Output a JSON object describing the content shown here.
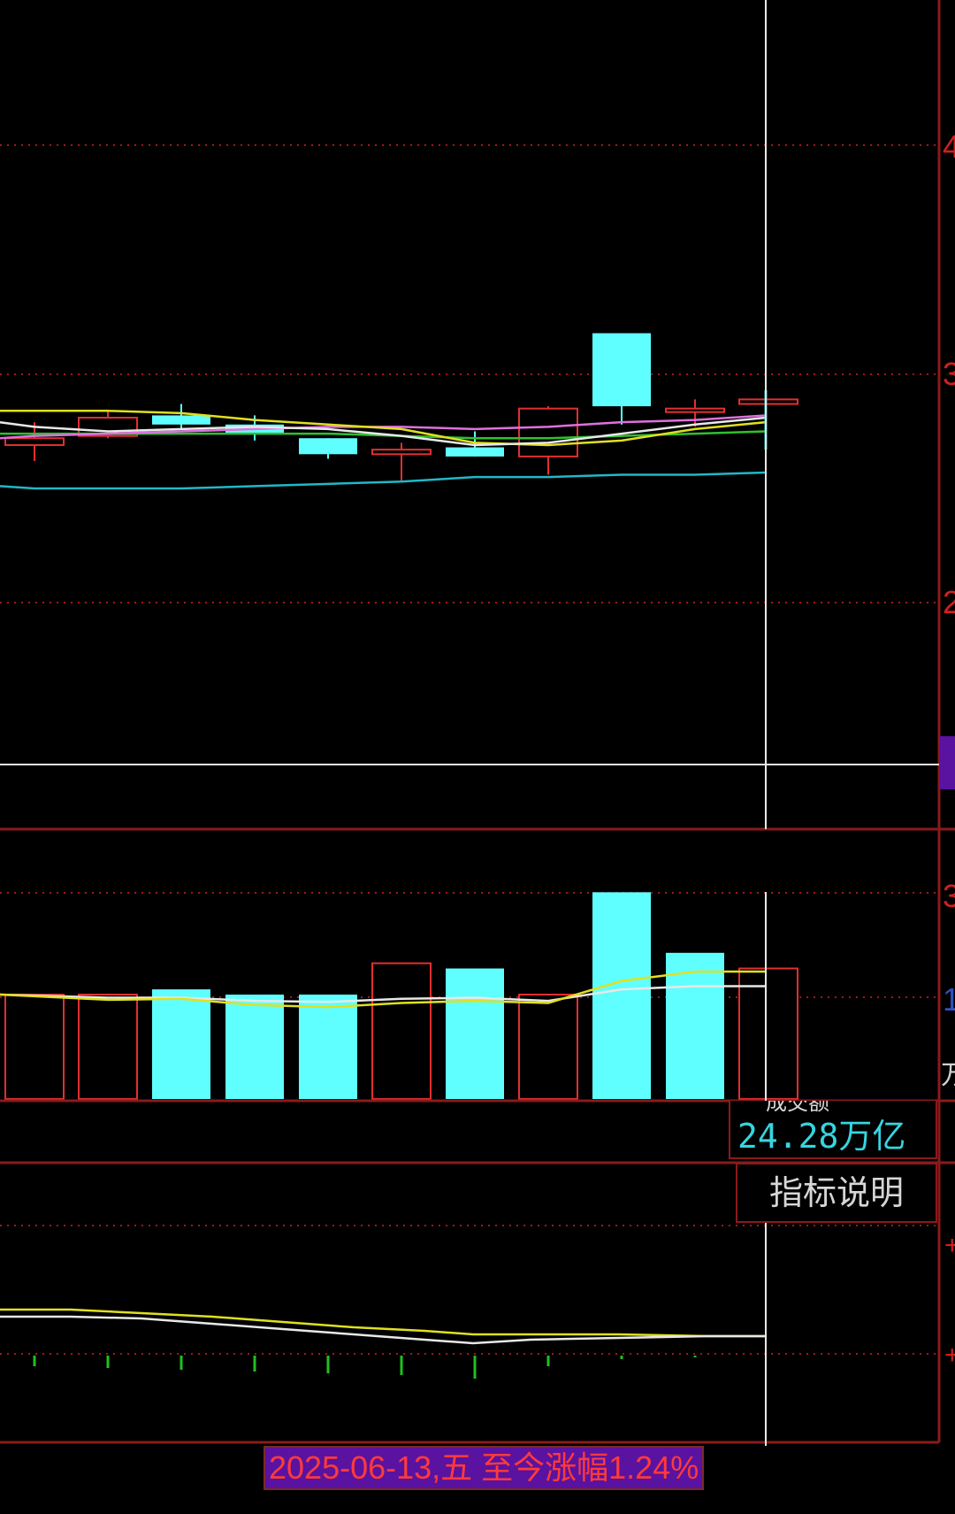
{
  "chart_data": [
    {
      "type": "candlestick",
      "panel": "price",
      "candles": [
        {
          "open": 2.69,
          "close": 2.72,
          "high": 2.79,
          "low": 2.62
        },
        {
          "open": 2.73,
          "close": 2.81,
          "high": 2.84,
          "low": 2.72
        },
        {
          "open": 2.82,
          "close": 2.78,
          "high": 2.87,
          "low": 2.76
        },
        {
          "open": 2.78,
          "close": 2.74,
          "high": 2.82,
          "low": 2.71
        },
        {
          "open": 2.72,
          "close": 2.65,
          "high": 2.72,
          "low": 2.63
        },
        {
          "open": 2.65,
          "close": 2.67,
          "high": 2.7,
          "low": 2.53
        },
        {
          "open": 2.68,
          "close": 2.64,
          "high": 2.75,
          "low": 2.64
        },
        {
          "open": 2.64,
          "close": 2.85,
          "high": 2.86,
          "low": 2.56
        },
        {
          "open": 3.18,
          "close": 2.86,
          "high": 3.18,
          "low": 2.78
        },
        {
          "open": 2.85,
          "close": 2.85,
          "high": 2.89,
          "low": 2.77
        },
        {
          "open": 2.87,
          "close": 2.89,
          "high": 2.89,
          "low": 2.87
        }
      ],
      "colors": {
        "up": "#e03030",
        "down": "#60ffff"
      }
    },
    {
      "type": "bar",
      "panel": "volume",
      "values": [
        1.0,
        1.0,
        1.05,
        1.0,
        1.0,
        1.3,
        1.25,
        1.0,
        1.98,
        1.4,
        1.25
      ],
      "directions": [
        "up",
        "up",
        "down",
        "down",
        "down",
        "up",
        "down",
        "up",
        "down",
        "down",
        "up"
      ]
    },
    {
      "type": "line",
      "panel": "indicator"
    }
  ],
  "amount": {
    "label": "成交额",
    "value": "24.28万亿"
  },
  "indicator_button": "指标说明",
  "footer": "2025-06-13,五 至今涨幅1.24%",
  "y_ticks": {
    "price": [
      "4",
      "3",
      "2"
    ],
    "volume": [
      "3",
      "1",
      "万"
    ],
    "indicator": [
      "+",
      "+"
    ]
  },
  "colors": {
    "background": "#000000",
    "border": "#8b1a1a",
    "grid": "#a01818",
    "ma_white": "#e8e8e8",
    "ma_yellow": "#e0e020",
    "ma_magenta": "#e070e0",
    "ma_green": "#30c030",
    "ma_cyan": "#20b8c8",
    "footer_bg": "#5a12a0",
    "footer_text": "#ff3a3a",
    "amount_text": "#35d6e0"
  }
}
